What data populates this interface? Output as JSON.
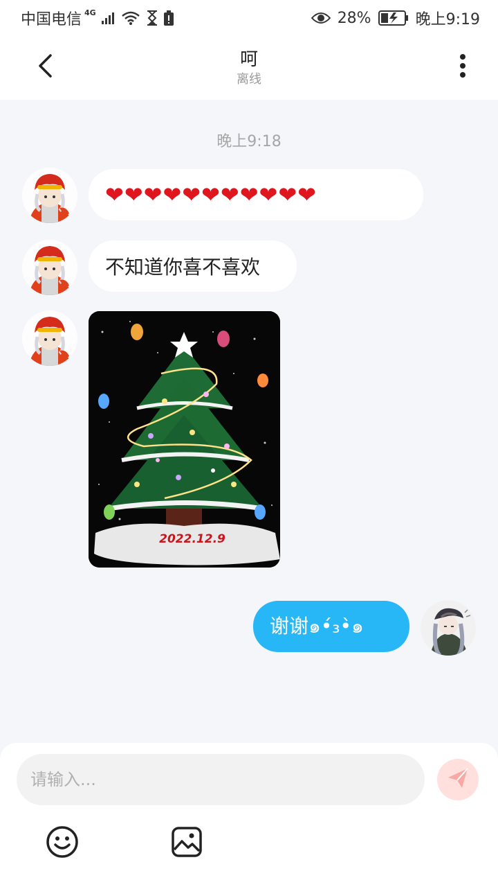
{
  "status_bar": {
    "carrier": "中国电信",
    "network": "4G",
    "battery_percent": "28%",
    "time": "晚上9:19"
  },
  "header": {
    "contact_name": "呵",
    "contact_status": "离线",
    "back_icon": "chevron-left-icon",
    "more_icon": "more-vertical-icon"
  },
  "chat": {
    "timestamp": "晚上9:18",
    "messages": [
      {
        "side": "received",
        "type": "text",
        "text": "❤❤❤❤❤❤❤❤❤❤❤"
      },
      {
        "side": "received",
        "type": "text",
        "text": "不知道你喜不喜欢"
      },
      {
        "side": "received",
        "type": "image",
        "image_caption": "2022.12.9"
      },
      {
        "side": "sent",
        "type": "text",
        "text": "谢谢๑•́₃•̀๑"
      }
    ]
  },
  "composer": {
    "placeholder": "请输入...",
    "send_icon": "paper-plane-icon",
    "emoji_icon": "smiley-icon",
    "image_icon": "image-icon"
  },
  "colors": {
    "sent_bubble": "#27b6f6",
    "received_bubble": "#ffffff",
    "background": "#f4f6f9",
    "heart": "#e0161f",
    "send_button": "#ffe0dd"
  }
}
